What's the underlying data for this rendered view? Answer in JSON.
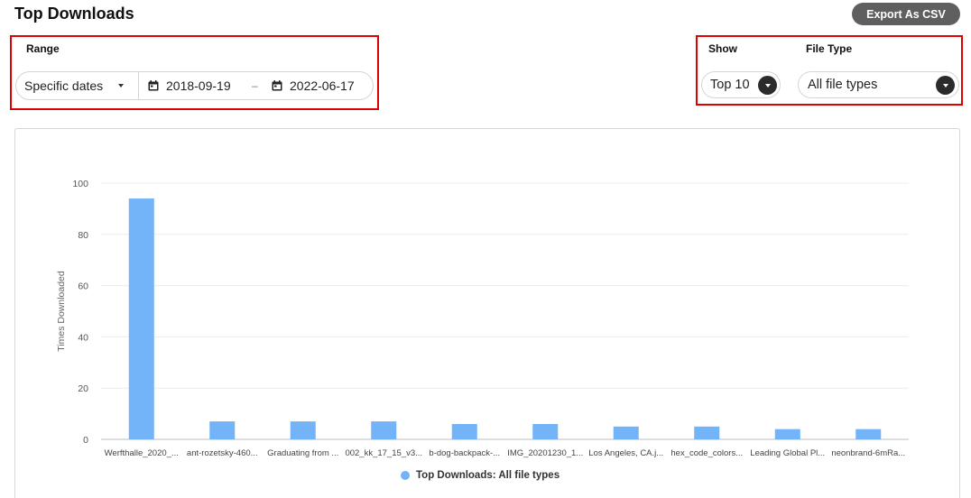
{
  "page": {
    "title": "Top Downloads",
    "export_label": "Export As CSV"
  },
  "filters": {
    "range_label": "Range",
    "range_value": "Specific dates",
    "date_from": "2018-09-19",
    "date_separator": "–",
    "date_to": "2022-06-17",
    "show_label": "Show",
    "show_value": "Top 10",
    "file_type_label": "File Type",
    "file_type_value": "All file types"
  },
  "colors": {
    "bar": "#72b4f7",
    "highlight": "#e00000",
    "button": "#5f5f5f"
  },
  "icons": {
    "calendar": "calendar-icon",
    "dropdown": "chevron-down-icon"
  },
  "chart_data": {
    "type": "bar",
    "categories": [
      "Werfthalle_2020_...",
      "ant-rozetsky-460...",
      "Graduating from ...",
      "002_kk_17_15_v3...",
      "b-dog-backpack-...",
      "IMG_20201230_1...",
      "Los Angeles, CA.j...",
      "hex_code_colors...",
      "Leading Global Pl...",
      "neonbrand-6mRa..."
    ],
    "series": [
      {
        "name": "Top Downloads: All file types",
        "values": [
          94,
          7,
          7,
          7,
          6,
          6,
          5,
          5,
          4,
          4
        ]
      }
    ],
    "ylabel": "Times Downloaded",
    "xlabel": "",
    "ylim": [
      0,
      100
    ],
    "yticks": [
      0,
      20,
      40,
      60,
      80,
      100
    ],
    "grid": true,
    "legend": "bottom"
  }
}
